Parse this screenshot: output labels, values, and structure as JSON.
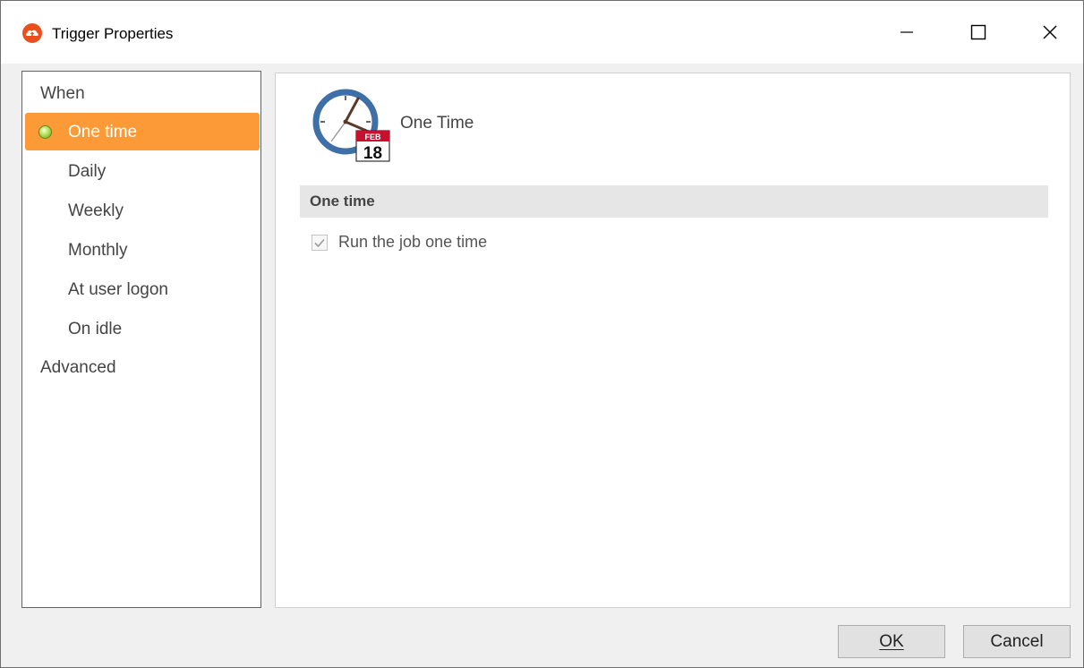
{
  "window": {
    "title": "Trigger Properties",
    "app_icon": "cloud-upload-icon"
  },
  "titlebar_buttons": {
    "minimize_icon": "minimize-icon",
    "maximize_icon": "maximize-icon",
    "close_icon": "close-icon"
  },
  "sidebar": {
    "group_when": "When",
    "items": [
      {
        "label": "One time",
        "selected": true,
        "icon": "green-bullet-icon"
      },
      {
        "label": "Daily",
        "selected": false
      },
      {
        "label": "Weekly",
        "selected": false
      },
      {
        "label": "Monthly",
        "selected": false
      },
      {
        "label": "At user logon",
        "selected": false
      },
      {
        "label": "On idle",
        "selected": false
      }
    ],
    "group_advanced": "Advanced"
  },
  "content": {
    "icon": "clock-calendar-icon",
    "icon_month": "FEB",
    "icon_day": "18",
    "title": "One Time",
    "section_header": "One time",
    "checkbox": {
      "label": "Run the job one time",
      "checked": true,
      "disabled": true
    }
  },
  "buttons": {
    "ok": "OK",
    "cancel": "Cancel"
  },
  "colors": {
    "selected_bg": "#fc9a38",
    "app_icon": "#e8511e",
    "clock_blue": "#3e6fa8",
    "calendar_red": "#c8102e"
  }
}
